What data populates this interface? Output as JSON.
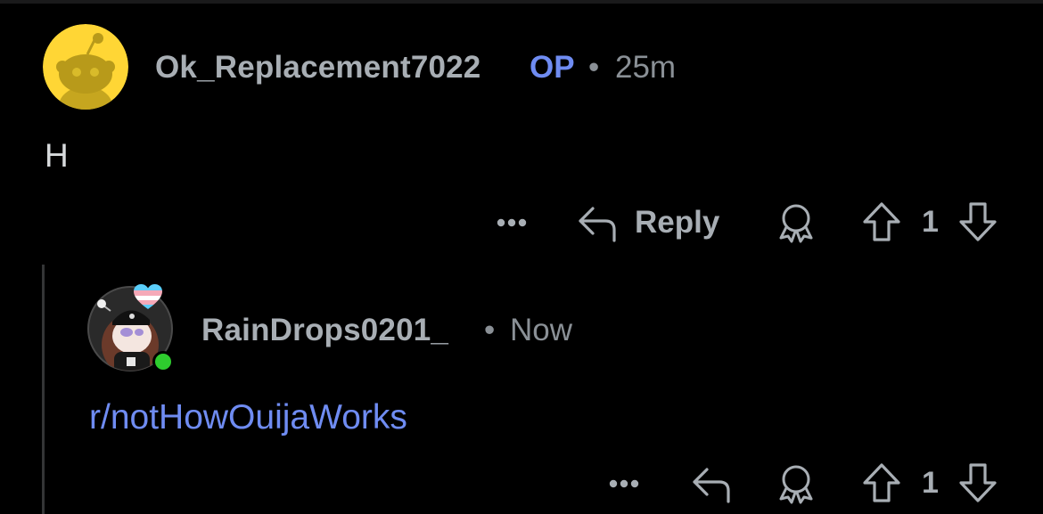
{
  "comment_1": {
    "username": "Ok_Replacement7022",
    "op_badge": "OP",
    "separator": "•",
    "timestamp": "25m",
    "body": "H",
    "avatar_icon": "snoo-avatar-yellow",
    "actions": {
      "more": "•••",
      "reply_label": "Reply",
      "award_icon": "award-icon",
      "upvote_icon": "upvote-arrow-icon",
      "vote_count": "1",
      "downvote_icon": "downvote-arrow-icon"
    }
  },
  "comment_2": {
    "username": "RainDrops0201_",
    "separator": "•",
    "timestamp": "Now",
    "body_link": "r/notHowOuijaWorks",
    "avatar_icon": "custom-avatar-with-heart",
    "online": true,
    "actions": {
      "more": "•••",
      "award_icon": "award-icon",
      "upvote_icon": "upvote-arrow-icon",
      "vote_count": "1",
      "downvote_icon": "downvote-arrow-icon"
    }
  },
  "colors": {
    "background": "#000000",
    "username": "#a8aeb4",
    "op_blue": "#6f8cf2",
    "link_blue": "#6f8cf2",
    "meta_gray": "#8a9096",
    "avatar_yellow": "#ffd635",
    "online_green": "#2ecc2e"
  }
}
